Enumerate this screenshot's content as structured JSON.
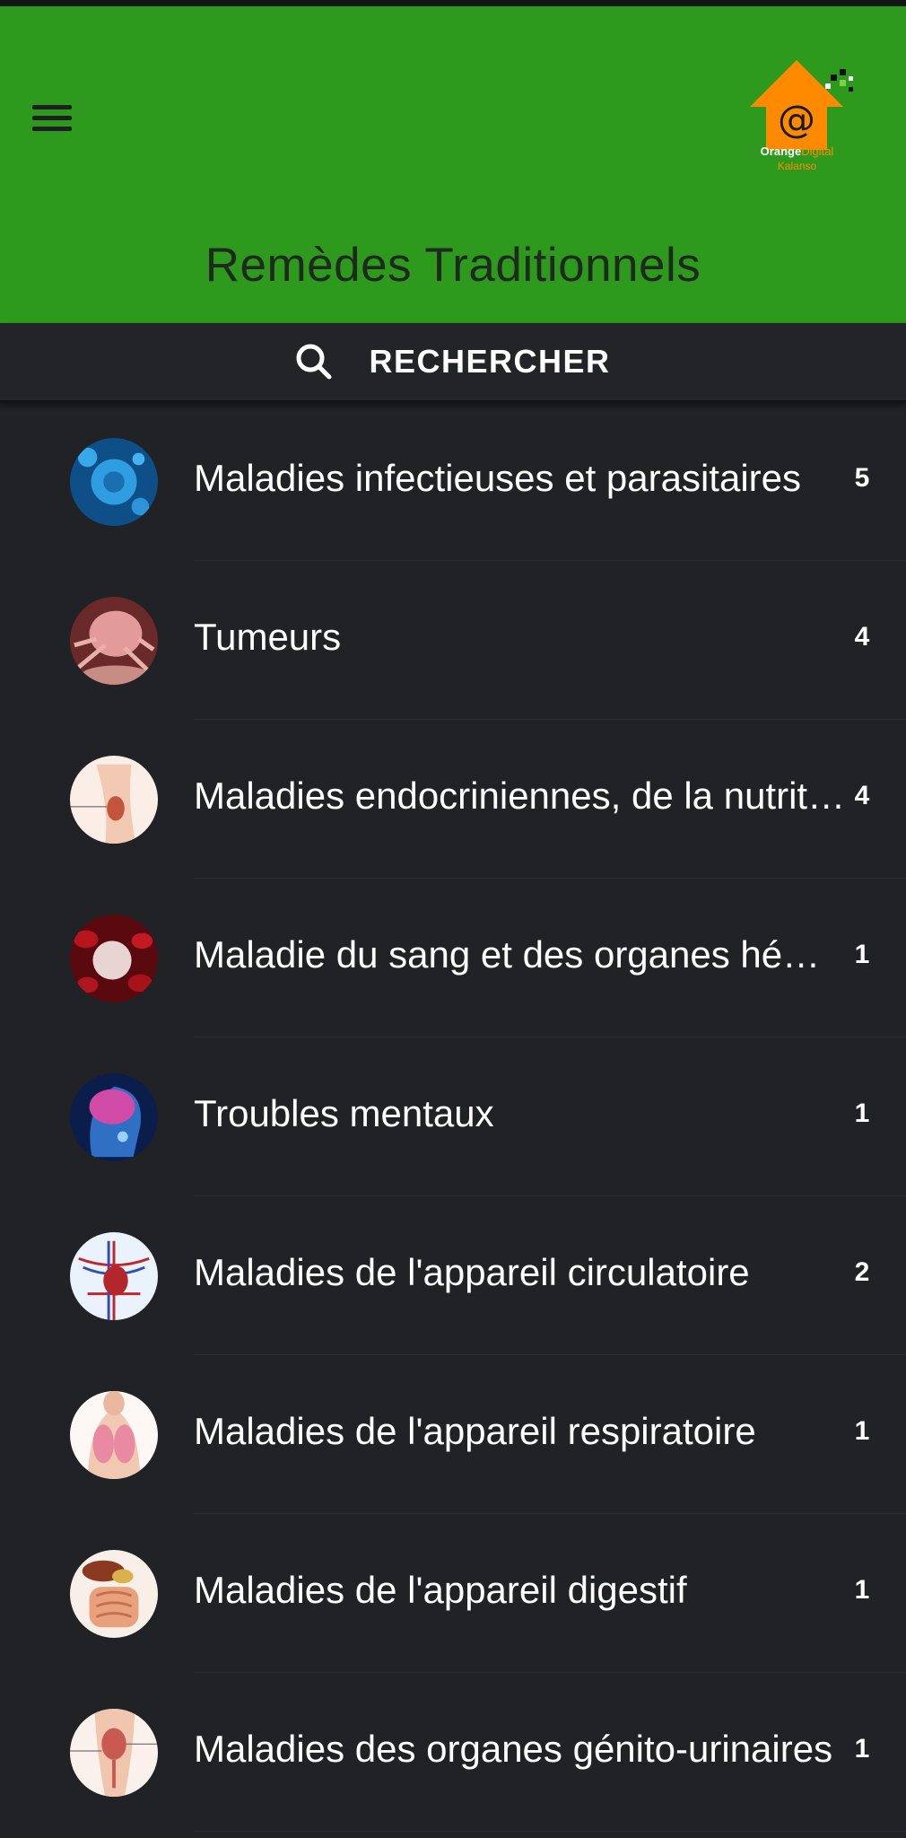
{
  "header": {
    "title": "Remèdes Traditionnels",
    "logo": {
      "brand": "Orange",
      "brand_suffix": "Digital",
      "sub": "Kalanso",
      "color": "#ff8a00"
    },
    "background": "#2e9a1d"
  },
  "search": {
    "label": "RECHERCHER",
    "icon": "search-icon"
  },
  "categories": [
    {
      "label": "Maladies infectieuses et parasitaires",
      "count": "5",
      "icon": "virus-icon"
    },
    {
      "label": "Tumeurs",
      "count": "4",
      "icon": "tumor-cell-icon"
    },
    {
      "label": "Maladies endocriniennes, de la nutrition et métaboliques",
      "count": "4",
      "icon": "thyroid-icon"
    },
    {
      "label": "Maladie du sang et des organes hématopoïétiques",
      "count": "1",
      "icon": "blood-cells-icon"
    },
    {
      "label": "Troubles mentaux",
      "count": "1",
      "icon": "brain-icon"
    },
    {
      "label": "Maladies de l'appareil circulatoire",
      "count": "2",
      "icon": "heart-icon"
    },
    {
      "label": "Maladies de l'appareil respiratoire",
      "count": "1",
      "icon": "lungs-icon"
    },
    {
      "label": "Maladies de l'appareil digestif",
      "count": "1",
      "icon": "digestive-system-icon"
    },
    {
      "label": "Maladies des organes génito-urinaires",
      "count": "1",
      "icon": "kidney-icon"
    }
  ]
}
